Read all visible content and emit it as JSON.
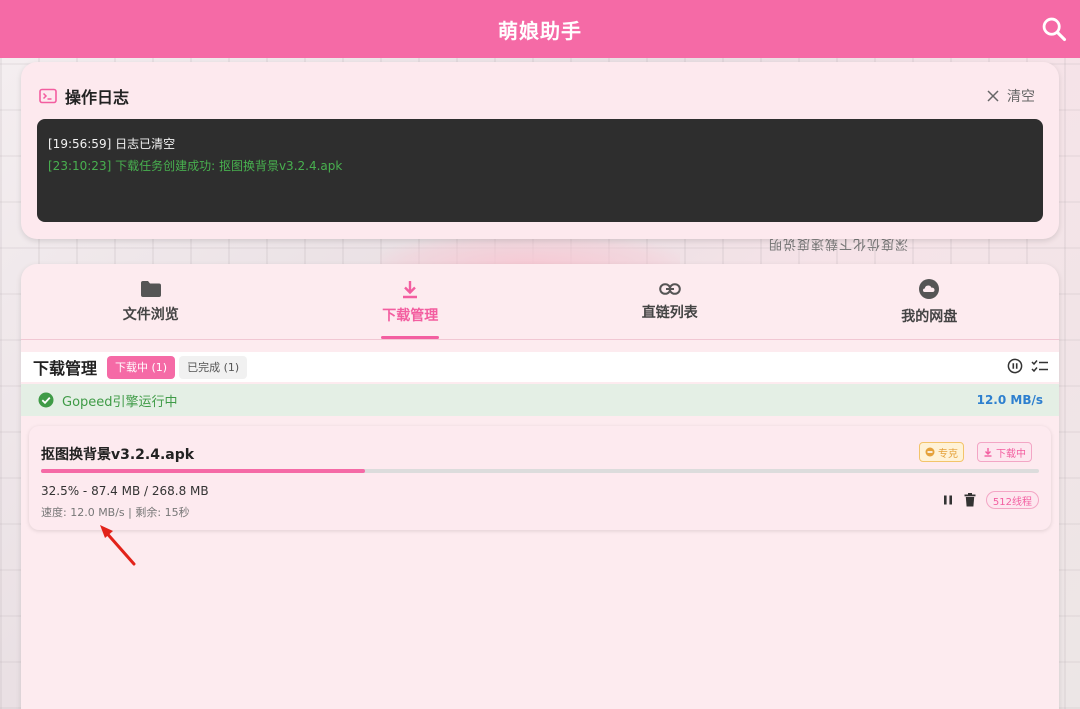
{
  "app": {
    "title": "萌娘助手"
  },
  "background": {
    "text": "深度优化下载速度说明"
  },
  "log": {
    "title": "操作日志",
    "clear_label": "清空",
    "lines": [
      {
        "time": "[19:56:59]",
        "message": "日志已清空",
        "status": "info"
      },
      {
        "time": "[23:10:23]",
        "message": "下载任务创建成功: 抠图换背景v3.2.4.apk",
        "status": "success"
      }
    ]
  },
  "tabs": [
    {
      "label": "文件浏览",
      "icon": "folder-icon",
      "active": false
    },
    {
      "label": "下载管理",
      "icon": "download-icon",
      "active": true
    },
    {
      "label": "直链列表",
      "icon": "link-icon",
      "active": false
    },
    {
      "label": "我的网盘",
      "icon": "cloud-icon",
      "active": false
    }
  ],
  "downloads": {
    "title": "下载管理",
    "filters": [
      {
        "label": "下载中 (1)",
        "active": true
      },
      {
        "label": "已完成 (1)",
        "active": false
      }
    ],
    "engine": {
      "label": "Gopeed引擎运行中",
      "speed": "12.0 MB/s"
    },
    "tasks": [
      {
        "name": "抠图换背景v3.2.4.apk",
        "vip_badge": "专克",
        "status_badge": "下载中",
        "progress": 0.325,
        "size_text": "32.5% - 87.4 MB / 268.8 MB",
        "speed_text": "速度: 12.0 MB/s | 剩余: 15秒",
        "threads": "512线程"
      }
    ]
  },
  "colors": {
    "brand": "#f56aa6",
    "success": "#3f9b47",
    "speed": "#2d7fcf"
  }
}
